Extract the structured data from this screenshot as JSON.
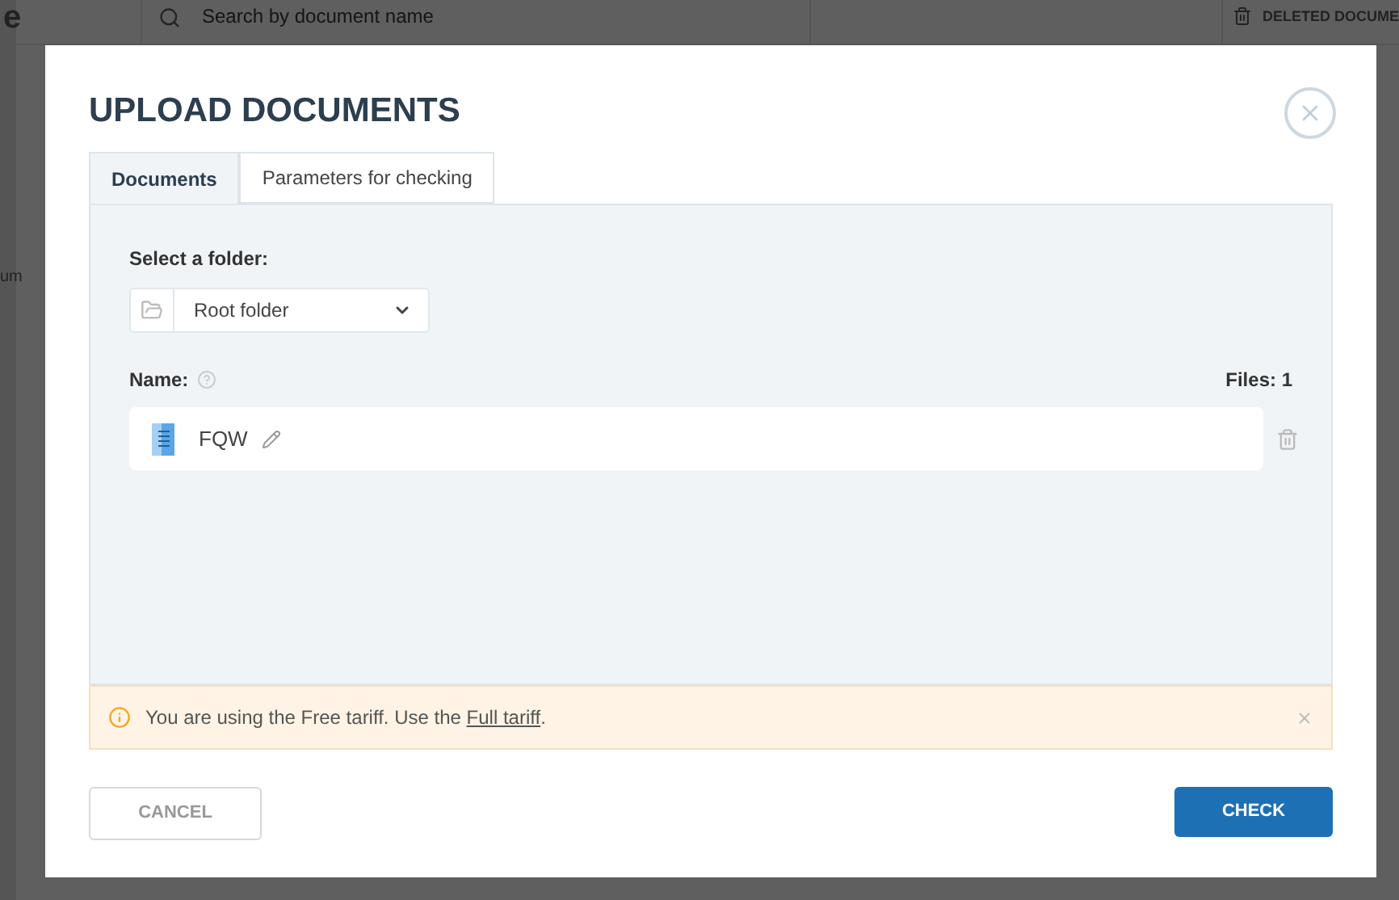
{
  "background": {
    "logo_fragment": "e",
    "side_fragment": "um",
    "search": {
      "placeholder": "Search by document name"
    },
    "deleted_button": "DELETED DOCUME"
  },
  "dialog": {
    "title": "UPLOAD DOCUMENTS",
    "tabs": [
      {
        "label": "Documents",
        "selected": true
      },
      {
        "label": "Parameters for checking",
        "selected": false
      }
    ],
    "folder_label": "Select a folder:",
    "folder_value": "Root folder",
    "name_label": "Name:",
    "files_count": "Files: 1",
    "files": [
      {
        "name": "FQW"
      }
    ],
    "alert": {
      "text_before": "You are using the Free tariff. Use the ",
      "link": "Full tariff",
      "text_after": "."
    },
    "buttons": [
      {
        "label": "CANCEL",
        "kind": "secondary"
      },
      {
        "label": "CHECK",
        "kind": "primary"
      }
    ]
  }
}
